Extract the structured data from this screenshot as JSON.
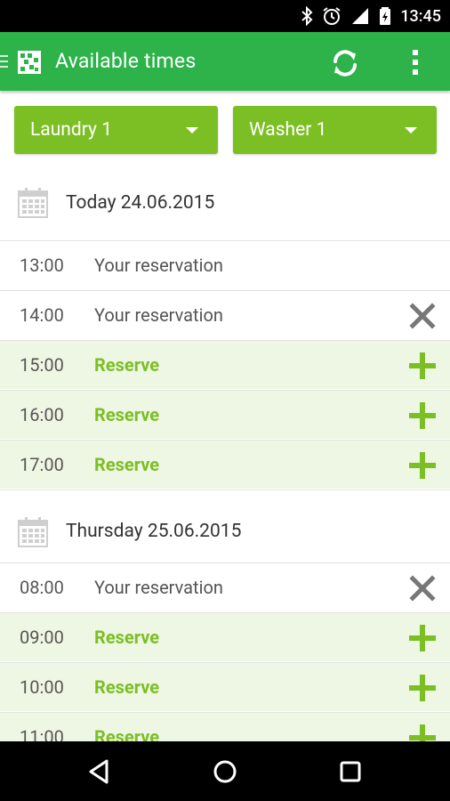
{
  "status_bar": {
    "time": "13:45"
  },
  "app_bar": {
    "title": "Available times"
  },
  "filters": {
    "laundry": "Laundry 1",
    "machine": "Washer 1"
  },
  "days": [
    {
      "date": "Today 24.06.2015",
      "slots": [
        {
          "time": "13:00",
          "label": "Your reservation",
          "action": ""
        },
        {
          "time": "14:00",
          "label": "Your reservation",
          "action": "cancel"
        },
        {
          "time": "15:00",
          "label": "Reserve",
          "action": "add"
        },
        {
          "time": "16:00",
          "label": "Reserve",
          "action": "add"
        },
        {
          "time": "17:00",
          "label": "Reserve",
          "action": "add"
        }
      ]
    },
    {
      "date": "Thursday 25.06.2015",
      "slots": [
        {
          "time": "08:00",
          "label": "Your reservation",
          "action": "cancel"
        },
        {
          "time": "09:00",
          "label": "Reserve",
          "action": "add"
        },
        {
          "time": "10:00",
          "label": "Reserve",
          "action": "add"
        },
        {
          "time": "11:00",
          "label": "Reserve",
          "action": "add"
        }
      ]
    }
  ],
  "colors": {
    "appbar": "#2db34a",
    "accent": "#7cbf24",
    "free_row": "#eef6e4"
  },
  "icons": {
    "status": [
      "bluetooth-icon",
      "alarm-icon",
      "signal-icon",
      "battery-icon"
    ],
    "app_bar": [
      "drawer-icon",
      "app-logo-icon",
      "refresh-icon",
      "overflow-menu-icon"
    ],
    "row_actions": {
      "cancel": "close-icon",
      "add": "plus-icon"
    },
    "nav": [
      "back-icon",
      "home-icon",
      "recents-icon"
    ]
  }
}
